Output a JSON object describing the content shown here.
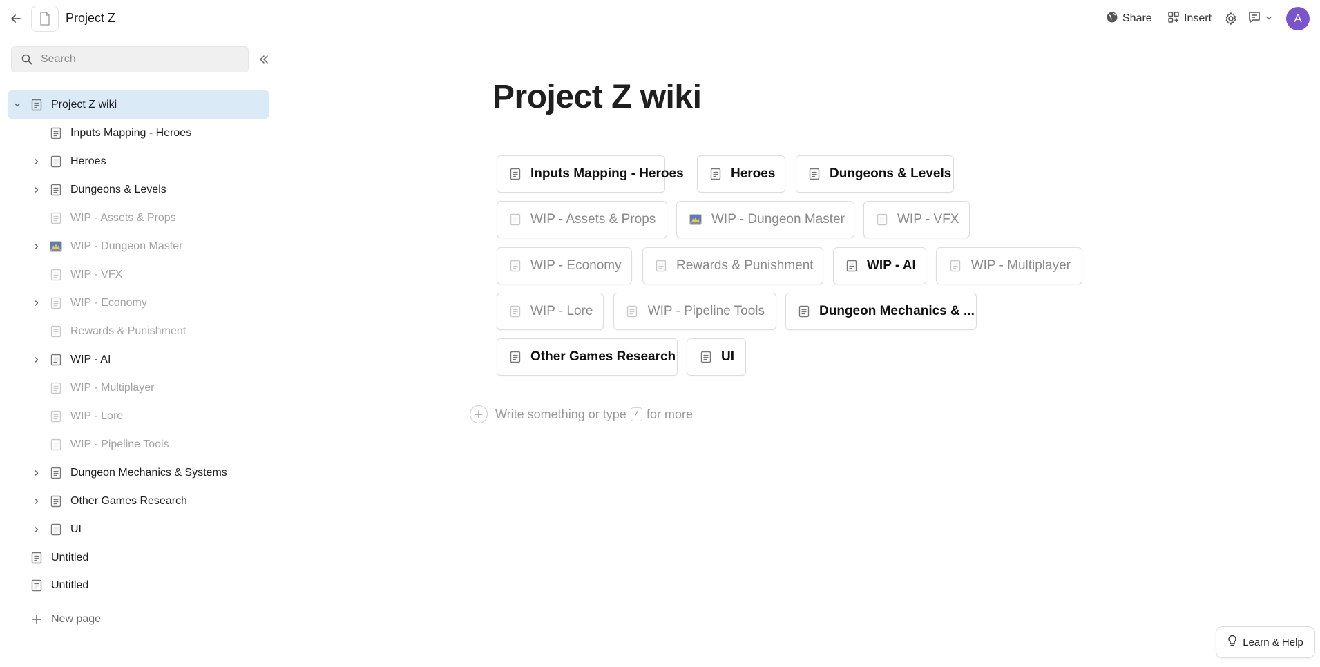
{
  "sidebar": {
    "project_title": "Project Z",
    "search_placeholder": "Search",
    "new_page_label": "New page",
    "items": [
      {
        "label": "Project Z wiki",
        "expanded": true,
        "selected": true,
        "muted": false,
        "icon": "page-icon"
      },
      {
        "label": "Inputs Mapping - Heroes",
        "muted": false,
        "icon": "page-icon"
      },
      {
        "label": "Heroes",
        "muted": false,
        "icon": "page-icon",
        "has_children": true
      },
      {
        "label": "Dungeons & Levels",
        "muted": false,
        "icon": "page-icon",
        "has_children": true
      },
      {
        "label": "WIP - Assets & Props",
        "muted": true,
        "icon": "page-icon"
      },
      {
        "label": "WIP - Dungeon Master",
        "muted": true,
        "icon": "image-thumb-icon",
        "has_children": true
      },
      {
        "label": "WIP - VFX",
        "muted": true,
        "icon": "page-icon"
      },
      {
        "label": "WIP - Economy",
        "muted": true,
        "icon": "page-icon",
        "has_children": true
      },
      {
        "label": "Rewards & Punishment",
        "muted": true,
        "icon": "page-icon"
      },
      {
        "label": "WIP - AI",
        "muted": false,
        "icon": "page-icon",
        "has_children": true
      },
      {
        "label": "WIP - Multiplayer",
        "muted": true,
        "icon": "page-icon"
      },
      {
        "label": "WIP - Lore",
        "muted": true,
        "icon": "page-icon"
      },
      {
        "label": "WIP - Pipeline Tools",
        "muted": true,
        "icon": "page-icon"
      },
      {
        "label": "Dungeon Mechanics & Systems",
        "muted": false,
        "icon": "page-icon",
        "has_children": true
      },
      {
        "label": "Other Games Research",
        "muted": false,
        "icon": "page-icon",
        "has_children": true
      },
      {
        "label": "UI",
        "muted": false,
        "icon": "page-icon",
        "has_children": true
      },
      {
        "label": "Untitled",
        "muted": false,
        "icon": "page-icon"
      },
      {
        "label": "Untitled",
        "muted": false,
        "icon": "page-icon"
      }
    ]
  },
  "topbar": {
    "share_label": "Share",
    "insert_label": "Insert",
    "avatar_initial": "A"
  },
  "main": {
    "title": "Project Z wiki",
    "chips": [
      {
        "label": "Inputs Mapping - Heroes",
        "muted": false
      },
      {
        "label": "Heroes",
        "muted": false
      },
      {
        "label": "Dungeons & Levels",
        "muted": false
      },
      {
        "label": "WIP - Assets & Props",
        "muted": true
      },
      {
        "label": "WIP - Dungeon Master",
        "muted": true,
        "icon": "image-thumb-icon"
      },
      {
        "label": "WIP - VFX",
        "muted": true
      },
      {
        "label": "WIP - Economy",
        "muted": true
      },
      {
        "label": "Rewards & Punishment",
        "muted": true
      },
      {
        "label": "WIP - AI",
        "muted": false
      },
      {
        "label": "WIP - Multiplayer",
        "muted": true
      },
      {
        "label": "WIP - Lore",
        "muted": true
      },
      {
        "label": "WIP - Pipeline Tools",
        "muted": true
      },
      {
        "label": "Dungeon Mechanics & ...",
        "muted": false
      },
      {
        "label": "Other Games Research",
        "muted": false
      },
      {
        "label": "UI",
        "muted": false
      }
    ],
    "write_prefix": "Write something or type",
    "write_key": "/",
    "write_suffix": "for more"
  },
  "help": {
    "label": "Learn & Help"
  },
  "colors": {
    "selected_bg": "#dbeaf7",
    "avatar_bg": "#7a55c9",
    "muted_text": "#a3a3a3"
  }
}
